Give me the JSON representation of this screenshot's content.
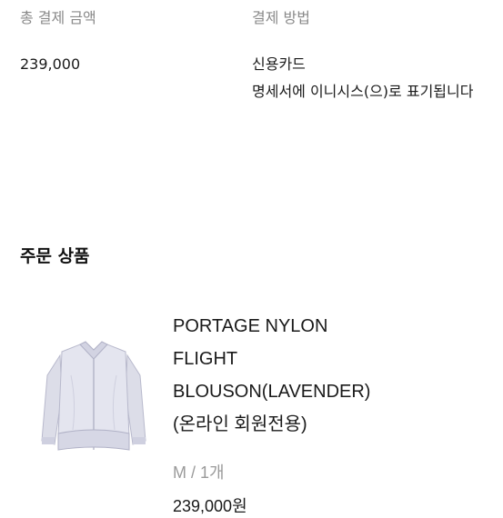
{
  "payment": {
    "total_label": "총 결제 금액",
    "method_label": "결제 방법",
    "total_amount": "239,000",
    "method_value": "신용카드",
    "method_note": "명세서에 이니시스(으)로 표기됩니다"
  },
  "order": {
    "section_title": "주문 상품",
    "product": {
      "name_line1": "PORTAGE NYLON",
      "name_line2": "FLIGHT",
      "name_line3": "BLOUSON(LAVENDER)",
      "name_line4": "(온라인 회원전용)",
      "option": "M / 1개",
      "price": "239,000원",
      "image_icon": "lavender-jacket-thumbnail"
    }
  }
}
